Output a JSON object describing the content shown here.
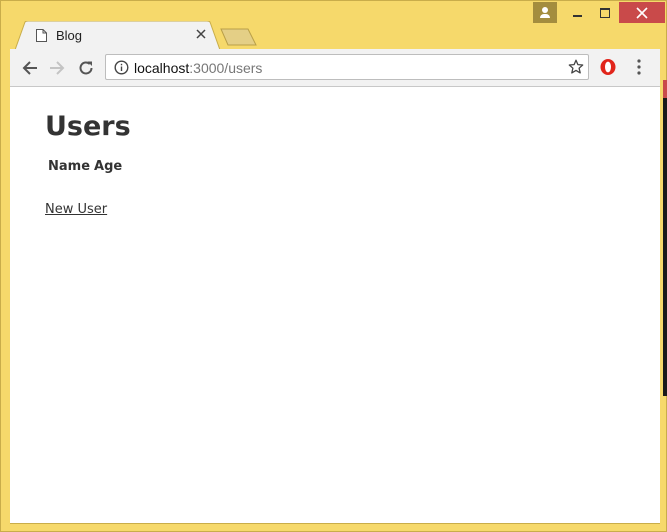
{
  "browser": {
    "tab_title": "Blog",
    "url_host": "localhost",
    "url_rest": ":3000/users"
  },
  "icons": {
    "back": "back-arrow-icon",
    "forward": "forward-arrow-icon",
    "reload": "reload-icon",
    "info": "info-icon",
    "star": "star-icon",
    "opera": "opera-extension-icon",
    "menu": "kebab-menu-icon",
    "doc": "document-icon"
  },
  "colors": {
    "window_frame": "#f6d96b",
    "close_button": "#c94a4a",
    "text": "#333333"
  },
  "page": {
    "title": "Users",
    "table": {
      "headers": [
        "Name",
        "Age"
      ]
    },
    "new_user_link": "New User"
  }
}
